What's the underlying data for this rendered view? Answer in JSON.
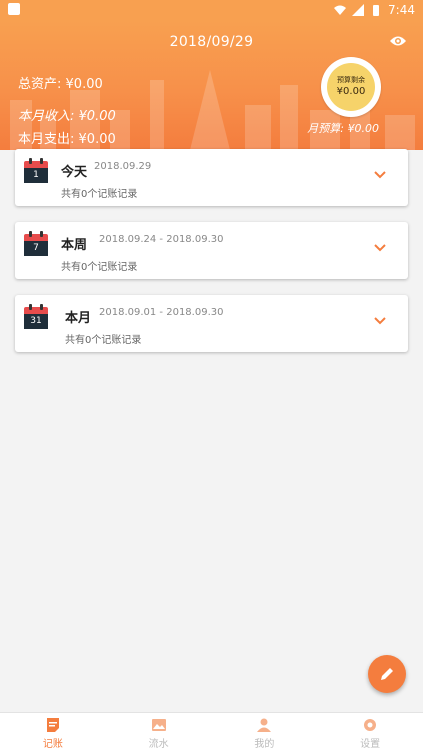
{
  "status_bar": {
    "time": "7:44"
  },
  "header": {
    "date": "2018/09/29",
    "total_assets_label": "总资产:",
    "total_assets_value": "¥0.00",
    "month_income_label": "本月收入:",
    "month_income_value": "¥0.00",
    "month_expense_label": "本月支出:",
    "month_expense_value": "¥0.00",
    "month_budget_label": "月预算:",
    "month_budget_value": "¥0.00",
    "budget_remaining_label": "预算剩余",
    "budget_remaining_value": "¥0.00"
  },
  "cards": [
    {
      "day": "1",
      "title": "今天",
      "range": "2018.09.29",
      "count": "共有0个记账记录"
    },
    {
      "day": "7",
      "title": "本周",
      "range": "2018.09.24 - 2018.09.30",
      "count": "共有0个记账记录"
    },
    {
      "day": "31",
      "title": "本月",
      "range": "2018.09.01 - 2018.09.30",
      "count": "共有0个记账记录"
    }
  ],
  "nav": [
    {
      "label": "记账",
      "icon": "notes-icon"
    },
    {
      "label": "流水",
      "icon": "image-icon"
    },
    {
      "label": "我的",
      "icon": "person-icon"
    },
    {
      "label": "设置",
      "icon": "gear-icon"
    }
  ],
  "colors": {
    "accent": "#f47d3e",
    "header_top": "#f8a050",
    "calendar_red": "#e74c4c",
    "badge": "#f6d36a"
  }
}
